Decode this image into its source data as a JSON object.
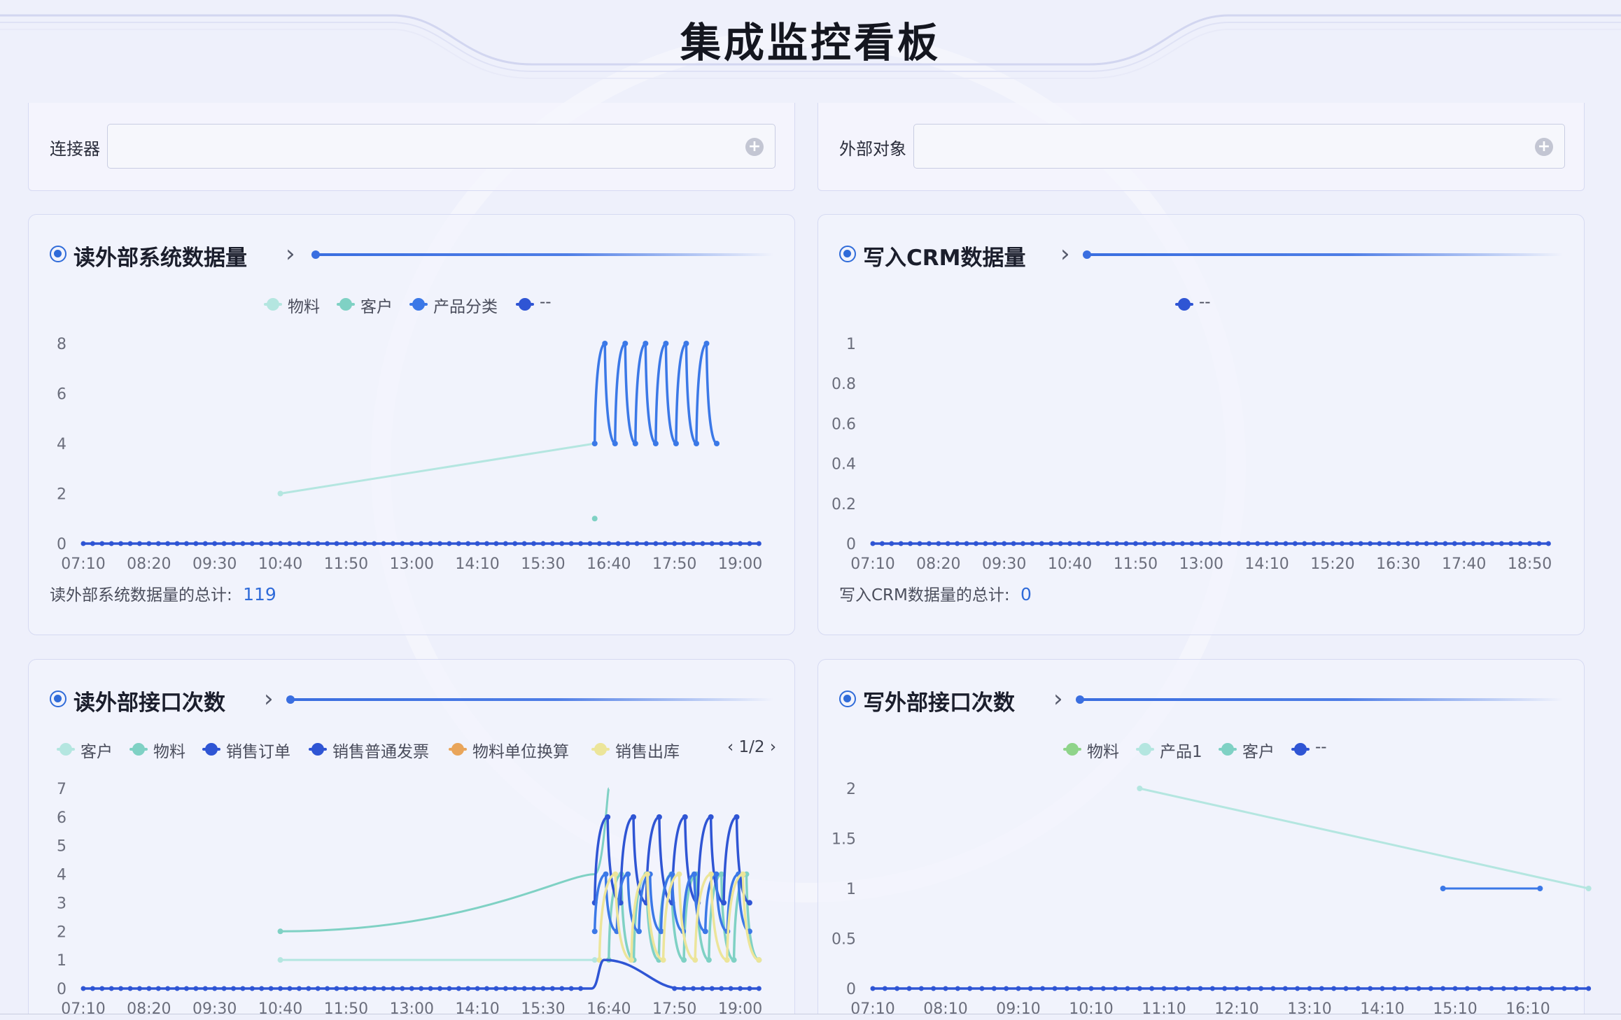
{
  "page_title": "集成监控看板",
  "filters": {
    "connector": {
      "label": "连接器",
      "value": "",
      "add_icon": "plus-circle-icon"
    },
    "external_object": {
      "label": "外部对象",
      "value": "",
      "add_icon": "plus-circle-icon"
    }
  },
  "colors": {
    "accent": "#2f6bd9",
    "series_light_teal": "#b4e6e0",
    "series_teal": "#7fd1c4",
    "series_blue": "#3b78e7",
    "series_dark_blue": "#2f55d4",
    "series_orange": "#e9a55a",
    "series_yellow": "#ece59a",
    "series_green": "#8fd48a"
  },
  "panels": [
    {
      "id": "read-external-volume",
      "title": "读外部系统数据量",
      "legend": [
        {
          "label": "物料",
          "color": "#b4e6e0"
        },
        {
          "label": "客户",
          "color": "#7fd1c4"
        },
        {
          "label": "产品分类",
          "color": "#3b78e7"
        },
        {
          "label": "--",
          "color": "#2f55d4"
        }
      ],
      "total_label": "读外部系统数据量的总计:",
      "total_value": "119"
    },
    {
      "id": "write-crm-volume",
      "title": "写入CRM数据量",
      "legend": [
        {
          "label": "--",
          "color": "#2f55d4"
        }
      ],
      "total_label": "写入CRM数据量的总计:",
      "total_value": "0"
    },
    {
      "id": "read-external-calls",
      "title": "读外部接口次数",
      "legend": [
        {
          "label": "客户",
          "color": "#b4e6e0"
        },
        {
          "label": "物料",
          "color": "#7fd1c4"
        },
        {
          "label": "销售订单",
          "color": "#2f55d4"
        },
        {
          "label": "销售普通发票",
          "color": "#2f55d4"
        },
        {
          "label": "物料单位换算",
          "color": "#e9a55a"
        },
        {
          "label": "销售出库",
          "color": "#ece59a"
        }
      ],
      "pager": "1/2"
    },
    {
      "id": "write-external-calls",
      "title": "写外部接口次数",
      "legend": [
        {
          "label": "物料",
          "color": "#8fd48a"
        },
        {
          "label": "产品1",
          "color": "#b4e6e0"
        },
        {
          "label": "客户",
          "color": "#7fd1c4"
        },
        {
          "label": "--",
          "color": "#2f55d4"
        }
      ]
    }
  ],
  "chart_data": [
    {
      "type": "line",
      "categories": [
        "07:10",
        "08:20",
        "09:30",
        "10:40",
        "11:50",
        "13:00",
        "14:10",
        "15:30",
        "16:40",
        "17:50",
        "19:00"
      ],
      "ylim": [
        0,
        8
      ],
      "yticks": [
        0,
        2,
        4,
        6,
        8
      ],
      "series": [
        {
          "name": "物料",
          "color": "#b4e6e0",
          "points": [
            [
              "10:40",
              2
            ],
            [
              "16:15",
              4
            ]
          ]
        },
        {
          "name": "客户",
          "color": "#7fd1c4",
          "points": [
            [
              "16:15",
              1
            ]
          ]
        },
        {
          "name": "产品分类",
          "color": "#3b78e7",
          "oscillate": {
            "from": "16:15",
            "to": "18:25",
            "low": 4,
            "high": 8,
            "peaks": 6
          }
        },
        {
          "name": "--",
          "color": "#2f55d4",
          "constant": 0,
          "from": "07:10",
          "to": "19:10"
        }
      ]
    },
    {
      "type": "line",
      "categories": [
        "07:10",
        "08:20",
        "09:30",
        "10:40",
        "11:50",
        "13:00",
        "14:10",
        "15:20",
        "16:30",
        "17:40",
        "18:50"
      ],
      "ylim": [
        0,
        1
      ],
      "yticks": [
        "0",
        "0.2",
        "0.4",
        "0.6",
        "0.8",
        "1"
      ],
      "series": [
        {
          "name": "--",
          "color": "#2f55d4",
          "constant": 0,
          "from": "07:10",
          "to": "19:10"
        }
      ]
    },
    {
      "type": "line",
      "categories": [
        "07:10",
        "08:20",
        "09:30",
        "10:40",
        "11:50",
        "13:00",
        "14:10",
        "15:30",
        "16:40",
        "17:50",
        "19:00"
      ],
      "ylim": [
        0,
        7
      ],
      "yticks": [
        0,
        1,
        2,
        3,
        4,
        5,
        6,
        7
      ],
      "series": [
        {
          "name": "客户",
          "color": "#b4e6e0",
          "points": [
            [
              "10:40",
              1
            ],
            [
              "16:15",
              1
            ]
          ]
        },
        {
          "name": "物料",
          "color": "#7fd1c4",
          "curve": [
            [
              "10:40",
              2
            ],
            [
              "16:15",
              4
            ],
            [
              "16:30",
              7
            ]
          ],
          "oscillate": {
            "from": "16:30",
            "to": "19:10",
            "low": 1,
            "high": 4,
            "peaks": 6
          }
        },
        {
          "name": "销售订单",
          "color": "#2f55d4",
          "oscillate": {
            "from": "16:15",
            "to": "19:00",
            "low": 3,
            "high": 6,
            "peaks": 6
          }
        },
        {
          "name": "销售普通发票",
          "color": "#3b78e7",
          "oscillate": {
            "from": "16:15",
            "to": "19:00",
            "low": 2,
            "high": 4,
            "peaks": 7
          }
        },
        {
          "name": "销售出库",
          "color": "#ece59a",
          "oscillate": {
            "from": "16:20",
            "to": "19:10",
            "low": 1,
            "high": 4,
            "peaks": 5
          }
        },
        {
          "name": "--",
          "color": "#2f55d4",
          "constant": 0,
          "from": "07:10",
          "to": "19:10",
          "bump": {
            "at": "16:25",
            "value": 1
          }
        }
      ]
    },
    {
      "type": "line",
      "categories": [
        "07:10",
        "08:10",
        "09:10",
        "10:10",
        "11:10",
        "12:10",
        "13:10",
        "14:10",
        "15:10",
        "16:10"
      ],
      "ylim": [
        0,
        2
      ],
      "yticks": [
        "0",
        "0.5",
        "1",
        "1.5",
        "2"
      ],
      "series": [
        {
          "name": "产品1",
          "color": "#b4e6e0",
          "points": [
            [
              "10:50",
              2
            ],
            [
              "17:00",
              1
            ]
          ]
        },
        {
          "name": "客户",
          "color": "#3b78e7",
          "points": [
            [
              "15:00",
              1
            ],
            [
              "16:20",
              1
            ]
          ]
        },
        {
          "name": "--",
          "color": "#2f55d4",
          "constant": 0,
          "from": "07:10",
          "to": "17:00"
        }
      ]
    }
  ]
}
